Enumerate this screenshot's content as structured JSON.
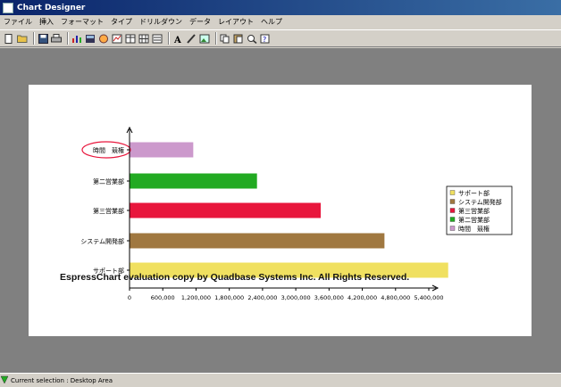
{
  "window": {
    "title": "Chart Designer"
  },
  "menu": [
    "ファイル",
    "挿入",
    "フォーマット",
    "タイプ",
    "ドリルダウン",
    "データ",
    "レイアウト",
    "ヘルプ"
  ],
  "toolbar_icons": [
    "new-icon",
    "open-icon",
    "save-icon",
    "print-icon",
    "chart-icon",
    "data-icon",
    "drill-icon",
    "insert-icon",
    "table-icon",
    "grid-icon",
    "list-icon",
    "text-icon",
    "pen-icon",
    "image-icon",
    "copy-icon",
    "paste-icon",
    "zoom-icon",
    "help-icon"
  ],
  "chart_data": {
    "type": "bar",
    "orientation": "horizontal",
    "categories": [
      "時間　競権",
      "第二営業部",
      "第三営業部",
      "システム開発部",
      "サポート部"
    ],
    "values": [
      1150000,
      2300000,
      3450000,
      4600000,
      5750000
    ],
    "colors": [
      "#cc99cc",
      "#22aa22",
      "#e8163c",
      "#a07840",
      "#f0e060"
    ],
    "xticks": [
      "0",
      "600,000",
      "1,200,000",
      "1,800,000",
      "2,400,000",
      "3,000,000",
      "3,600,000",
      "4,200,000",
      "4,800,000",
      "5,400,000"
    ],
    "xlim": [
      0,
      5400000
    ],
    "legend": {
      "position": "right",
      "entries": [
        {
          "label": "サポート部",
          "color": "#f0e060"
        },
        {
          "label": "システム開発部",
          "color": "#a07840"
        },
        {
          "label": "第三営業部",
          "color": "#e8163c"
        },
        {
          "label": "第二営業部",
          "color": "#22aa22"
        },
        {
          "label": "時間　競権",
          "color": "#cc99cc"
        }
      ]
    },
    "highlighted_category": "時間　競権"
  },
  "watermark": "EspressChart evaluation copy by Quadbase Systems Inc. All Rights Reserved.",
  "status": {
    "text": "Current selection : Desktop Area"
  }
}
